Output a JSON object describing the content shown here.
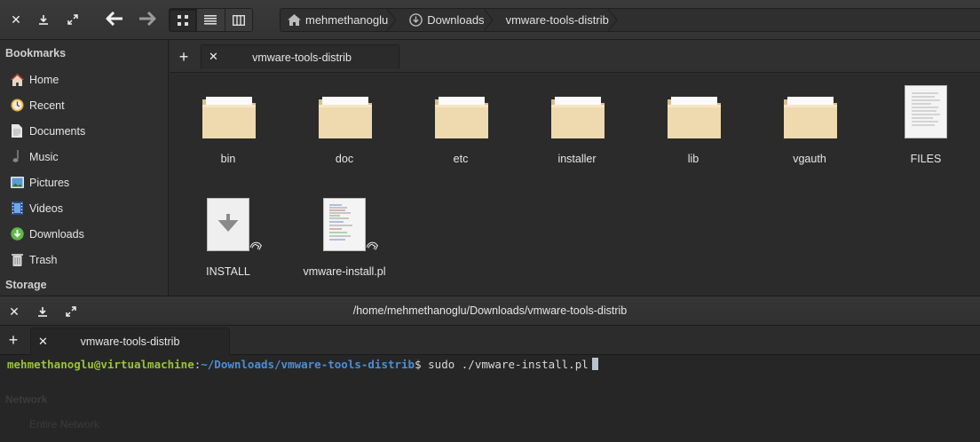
{
  "file_manager": {
    "breadcrumb": [
      "mehmethanoglu",
      "Downloads",
      "vmware-tools-distrib"
    ],
    "tab_label": "vmware-tools-distrib",
    "sidebar": {
      "bookmarks_heading": "Bookmarks",
      "items": [
        {
          "label": "Home",
          "icon": "home-icon"
        },
        {
          "label": "Recent",
          "icon": "recent-icon"
        },
        {
          "label": "Documents",
          "icon": "documents-icon"
        },
        {
          "label": "Music",
          "icon": "music-icon"
        },
        {
          "label": "Pictures",
          "icon": "pictures-icon"
        },
        {
          "label": "Videos",
          "icon": "videos-icon"
        },
        {
          "label": "Downloads",
          "icon": "downloads-icon"
        },
        {
          "label": "Trash",
          "icon": "trash-icon"
        }
      ],
      "storage_heading": "Storage",
      "network_heading": "Network",
      "network_item": "Entire Network"
    },
    "files": [
      {
        "name": "bin",
        "type": "folder"
      },
      {
        "name": "doc",
        "type": "folder"
      },
      {
        "name": "etc",
        "type": "folder"
      },
      {
        "name": "installer",
        "type": "folder"
      },
      {
        "name": "lib",
        "type": "folder"
      },
      {
        "name": "vgauth",
        "type": "folder"
      },
      {
        "name": "FILES",
        "type": "text"
      },
      {
        "name": "INSTALL",
        "type": "install-link"
      },
      {
        "name": "vmware-install.pl",
        "type": "script-link"
      }
    ]
  },
  "terminal": {
    "title": "/home/mehmethanoglu/Downloads/vmware-tools-distrib",
    "tab_label": "vmware-tools-distrib",
    "prompt_user": "mehmethanoglu@virtualmachine",
    "prompt_colon": ":",
    "prompt_path": "~/Downloads/vmware-tools-distrib",
    "prompt_symbol": "$",
    "command": "sudo ./vmware-install.pl"
  },
  "colors": {
    "prompt_user": "#9ac435",
    "prompt_path": "#4a8fd6",
    "folder": "#efd9ae"
  }
}
